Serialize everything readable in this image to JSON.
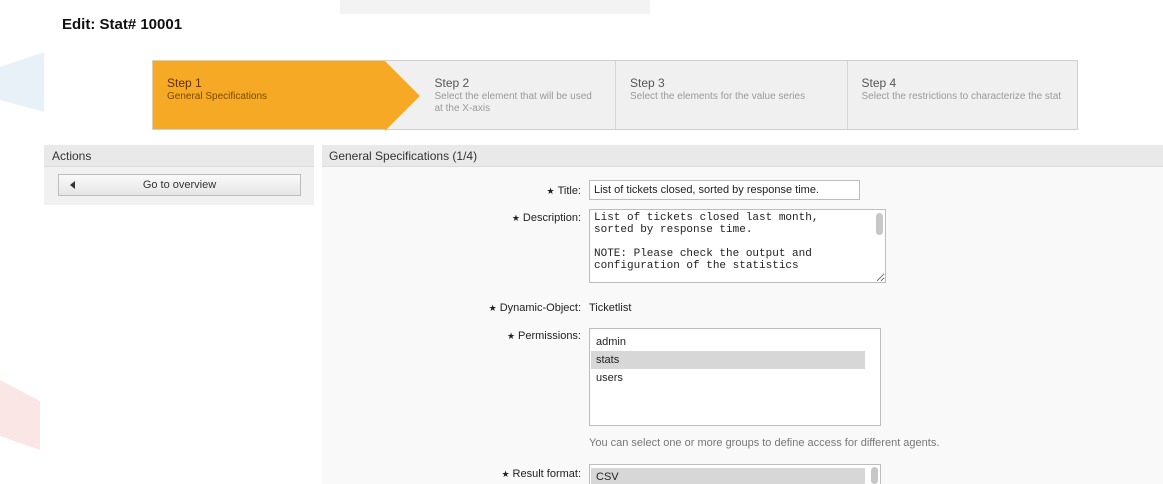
{
  "page": {
    "title": "Edit: Stat# 10001"
  },
  "steps": [
    {
      "title": "Step 1",
      "desc": "General Specifications"
    },
    {
      "title": "Step 2",
      "desc": "Select the element that will be used at the X-axis"
    },
    {
      "title": "Step 3",
      "desc": "Select the elements for the value series"
    },
    {
      "title": "Step 4",
      "desc": "Select the restrictions to characterize the stat"
    }
  ],
  "sidebar": {
    "header": "Actions",
    "overview_button": "Go to overview"
  },
  "main": {
    "header": "General Specifications (1/4)",
    "title_label": "Title:",
    "title_value": "List of tickets closed, sorted by response time.",
    "description_label": "Description:",
    "description_value": "List of tickets closed last month,\nsorted by response time.\n\nNOTE: Please check the output and\nconfiguration of the statistics",
    "dynamic_object_label": "Dynamic-Object:",
    "dynamic_object_value": "Ticketlist",
    "permissions_label": "Permissions:",
    "permissions_options": [
      "admin",
      "stats",
      "users"
    ],
    "permissions_selected": "stats",
    "permissions_hint": "You can select one or more groups to define access for different agents.",
    "result_format_label": "Result format:",
    "result_format_options": [
      "CSV"
    ]
  },
  "required_marker": "★"
}
